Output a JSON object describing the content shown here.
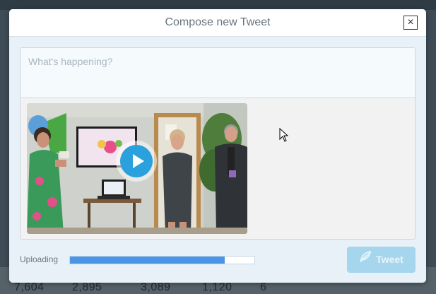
{
  "background": {
    "stats": [
      "7,604",
      "2,895",
      "3,089",
      "1,120",
      "6"
    ]
  },
  "modal": {
    "title": "Compose new Tweet",
    "close_symbol": "×"
  },
  "composer": {
    "placeholder": "What's happening?",
    "text": ""
  },
  "media": {
    "type": "video",
    "icon": "play-icon"
  },
  "footer": {
    "upload_label": "Uploading",
    "upload_progress": 0.84,
    "tweet_label": "Tweet",
    "tweet_icon": "feather-icon"
  },
  "colors": {
    "accent": "#2aa0dc",
    "progress": "#4b95e6",
    "tweet_button_disabled": "#a6d6ee"
  }
}
